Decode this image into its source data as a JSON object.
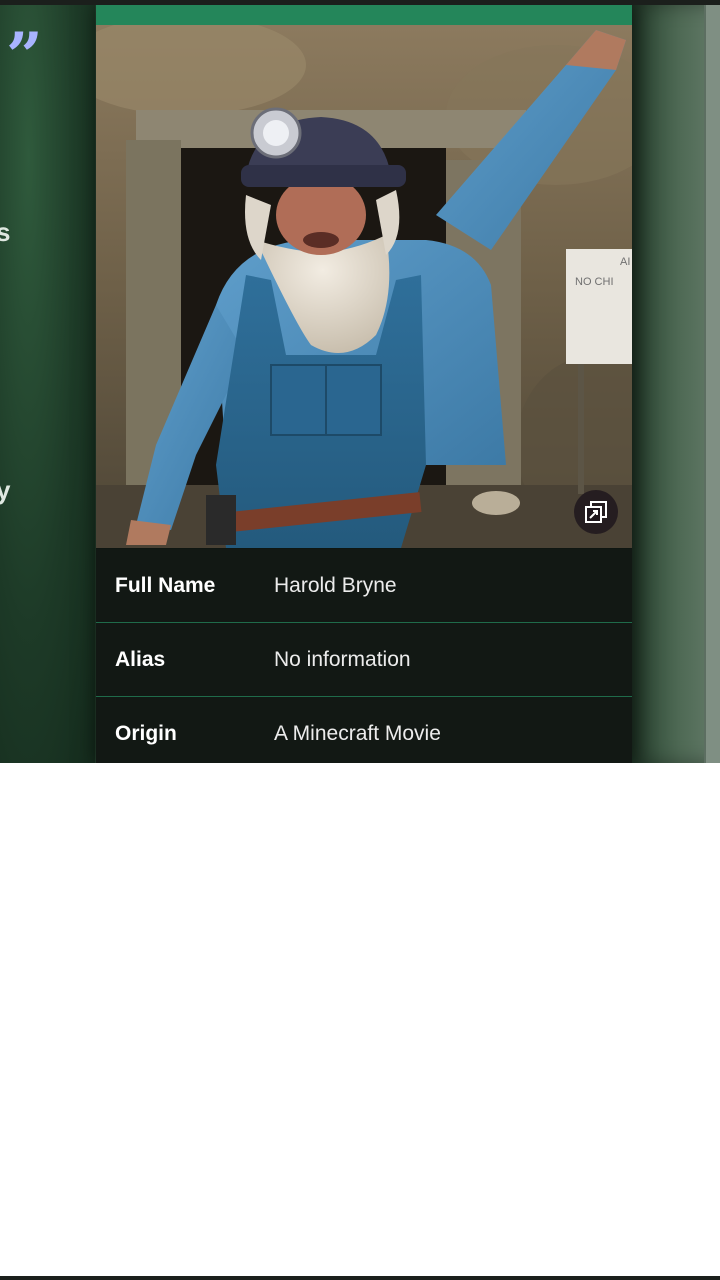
{
  "quote_glyph": "”",
  "left_edge_glyphs": [
    "s",
    "y"
  ],
  "photo": {
    "sign_text": [
      "AI",
      "NO CHI"
    ]
  },
  "gallery_icon": "gallery-stack-icon",
  "info": [
    {
      "key": "Full Name",
      "value": "Harold Bryne"
    },
    {
      "key": "Alias",
      "value": "No information"
    },
    {
      "key": "Origin",
      "value": "A Minecraft Movie"
    }
  ],
  "colors": {
    "accent_bar": "#24865a",
    "row_divider": "#1f6b4a",
    "quote": "#a8b4ff"
  }
}
